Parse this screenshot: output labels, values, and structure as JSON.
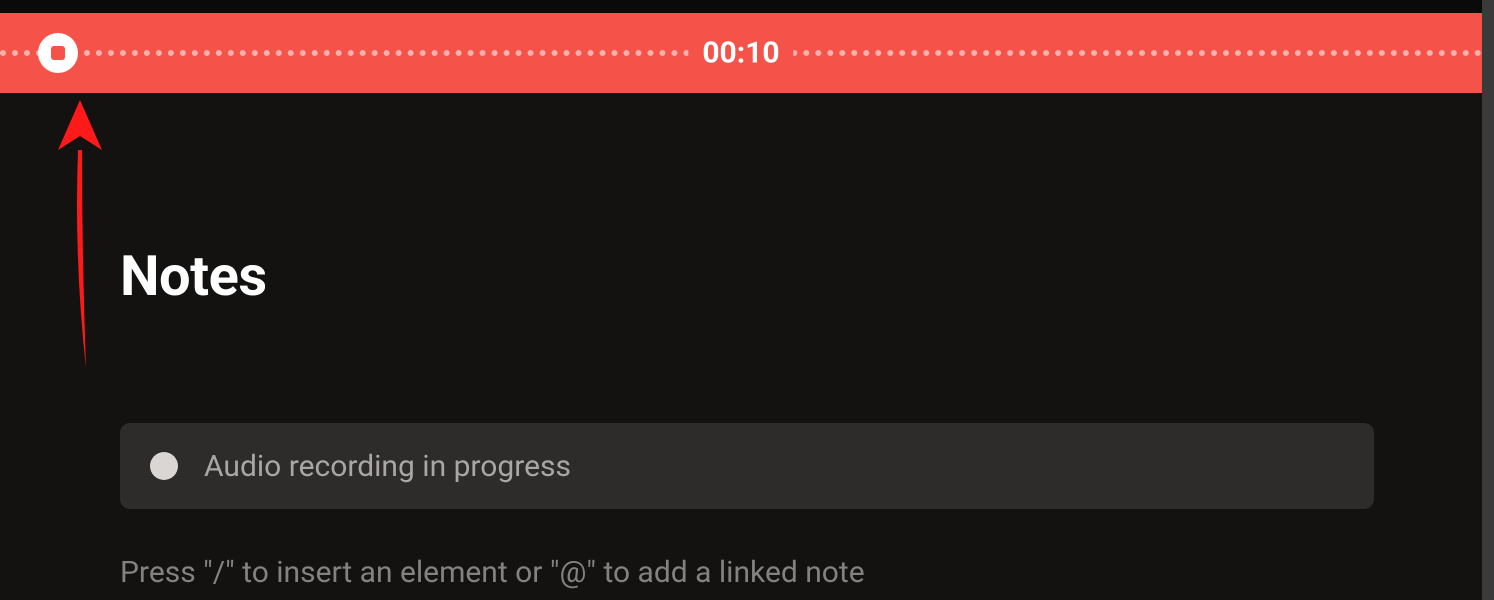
{
  "recording": {
    "elapsed_time": "00:10",
    "stop_icon_name": "stop-icon"
  },
  "page": {
    "title": "Notes"
  },
  "status_block": {
    "indicator_icon": "record-indicator-icon",
    "text": "Audio recording in progress"
  },
  "editor": {
    "placeholder_hint": "Press \"/\" to insert an element or \"@\" to add a linked note"
  },
  "colors": {
    "recording_bar": "#f55349",
    "background": "#131211",
    "status_row_bg": "#2d2c2b"
  }
}
